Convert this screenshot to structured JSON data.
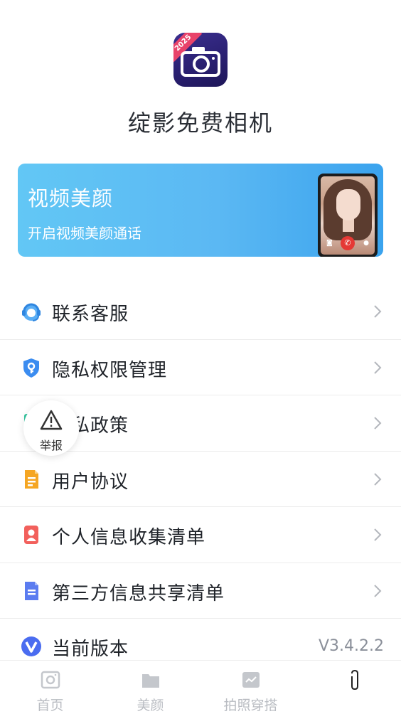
{
  "app": {
    "logo_badge": "2025",
    "title": "绽影免费相机"
  },
  "banner": {
    "title": "视频美颜",
    "subtitle": "开启视频美颜通话"
  },
  "menu": {
    "items": [
      {
        "label": "联系客服",
        "icon": "headset-icon",
        "color": "#3b9cf0"
      },
      {
        "label": "隐私权限管理",
        "icon": "shield-key-icon",
        "color": "#3b8cf0"
      },
      {
        "label": "隐私政策",
        "icon": "document-icon",
        "color": "#36c6a0"
      },
      {
        "label": "用户协议",
        "icon": "document-lines-icon",
        "color": "#f5a623"
      },
      {
        "label": "个人信息收集清单",
        "icon": "person-card-icon",
        "color": "#f2605c"
      },
      {
        "label": "第三方信息共享清单",
        "icon": "document-lines-icon",
        "color": "#5b7cf0"
      },
      {
        "label": "当前版本",
        "icon": "v-badge-icon",
        "color": "#4a6cf0",
        "value": "V3.4.2.2"
      }
    ]
  },
  "report": {
    "label": "举报"
  },
  "tabs": [
    {
      "label": "首页",
      "icon": "camera-icon"
    },
    {
      "label": "美颜",
      "icon": "folder-icon"
    },
    {
      "label": "拍照穿搭",
      "icon": "image-icon"
    },
    {
      "label": "",
      "icon": "paperclip-icon",
      "active": true
    }
  ],
  "colors": {
    "banner_gradient_start": "#62c7f5",
    "banner_gradient_end": "#3aa3ee",
    "tab_inactive": "#b9bcc2"
  }
}
